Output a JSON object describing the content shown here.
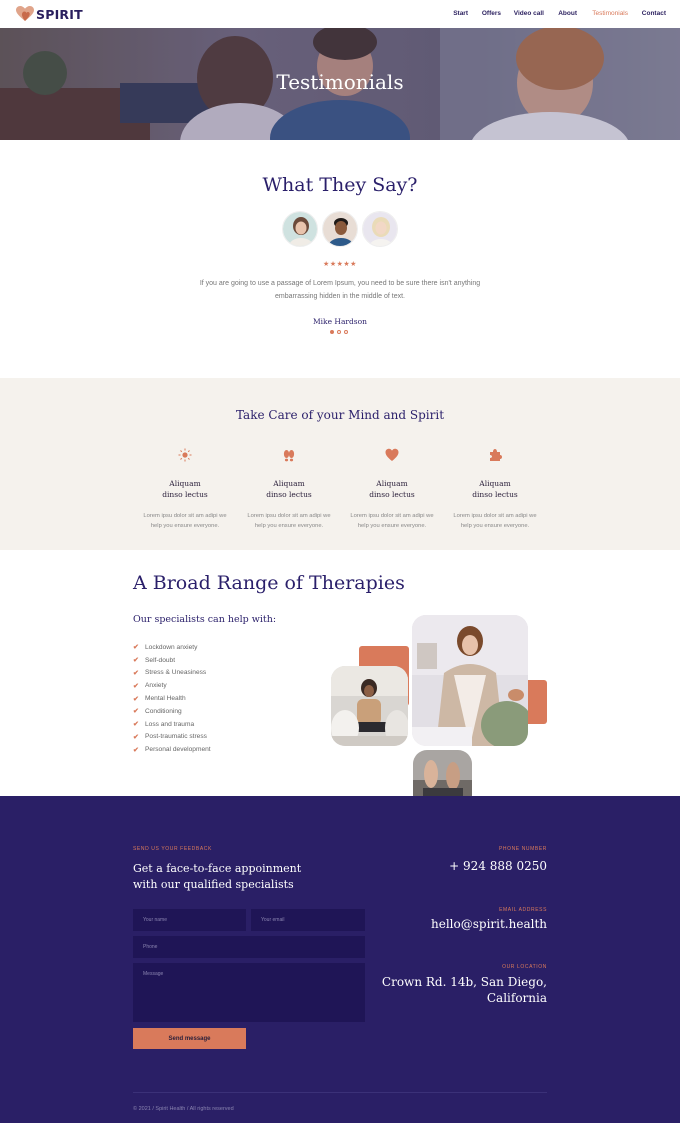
{
  "brand": {
    "name": "SPIRIT",
    "accent": "#d97a5b",
    "navy": "#2a1f66"
  },
  "nav": {
    "items": [
      {
        "label": "Start"
      },
      {
        "label": "Offers"
      },
      {
        "label": "Video call"
      },
      {
        "label": "About"
      },
      {
        "label": "Testimonials",
        "active": true
      },
      {
        "label": "Contact"
      }
    ]
  },
  "hero": {
    "title": "Testimonials"
  },
  "testimonials": {
    "title": "What They Say?",
    "stars": "★★★★★",
    "rating": 5,
    "quote": "If you are going to use a passage of Lorem Ipsum, you need to be sure there isn't anything embarrassing hidden in the middle of text.",
    "author": "Mike Hardson",
    "slide_count": 3,
    "active_slide": 1
  },
  "care": {
    "title": "Take Care of your Mind and Spirit",
    "features": [
      {
        "icon": "sun-icon",
        "name_line1": "Aliquam",
        "name_line2": "dinso lectus",
        "desc_line1": "Lorem ipsu dolor sit am adipi we",
        "desc_line2": "help you ensure everyone."
      },
      {
        "icon": "footprints-icon",
        "name_line1": "Aliquam",
        "name_line2": "dinso lectus",
        "desc_line1": "Lorem ipsu dolor sit am adipi we",
        "desc_line2": "help you ensure everyone."
      },
      {
        "icon": "heart-icon",
        "name_line1": "Aliquam",
        "name_line2": "dinso lectus",
        "desc_line1": "Lorem ipsu dolor sit am adipi we",
        "desc_line2": "help you ensure everyone."
      },
      {
        "icon": "puzzle-icon",
        "name_line1": "Aliquam",
        "name_line2": "dinso lectus",
        "desc_line1": "Lorem ipsu dolor sit am adipi we",
        "desc_line2": "help you ensure everyone."
      }
    ]
  },
  "therapies": {
    "title": "A Broad Range of Therapies",
    "subtitle": "Our specialists can help with:",
    "items": [
      "Lockdown anxiety",
      "Self-doubt",
      "Stress & Uneasiness",
      "Anxiety",
      "Mental Health",
      "Conditioning",
      "Loss and trauma",
      "Post-traumatic stress",
      "Personal development"
    ]
  },
  "contact": {
    "feedback_label": "SEND US YOUR FEEDBACK",
    "heading_line1": "Get a face-to-face appoinment",
    "heading_line2": "with our qualified specialists",
    "form": {
      "name_placeholder": "Your name",
      "email_placeholder": "Your email",
      "phone_placeholder": "Phone",
      "message_placeholder": "Message",
      "send_label": "Send message"
    },
    "phone_label": "PHONE NUMBER",
    "phone": "+ 924 888 0250",
    "email_label": "EMAIL ADDRESS",
    "email": "hello@spirit.health",
    "location_label": "OUR LOCATION",
    "address_line1": "Crown Rd. 14b, San Diego,",
    "address_line2": "California",
    "copyright": "© 2021 / Spirit Health / All rights reserved"
  }
}
